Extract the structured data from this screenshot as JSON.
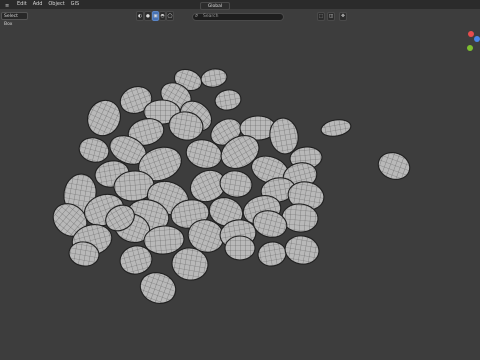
{
  "menu": {
    "items": [
      "Edit",
      "Add",
      "Object",
      "GIS"
    ]
  },
  "header": {
    "mode_select": "Select Box"
  },
  "toolbar": {
    "transform_orientation": "Global",
    "search_placeholder": "Search"
  },
  "gizmo": {
    "x_color": "#e64d4d",
    "y_color": "#7dbf2e",
    "z_color": "#4a86e8"
  },
  "scene": {
    "object": "pebble-pile",
    "wireframe_overlay": true
  }
}
